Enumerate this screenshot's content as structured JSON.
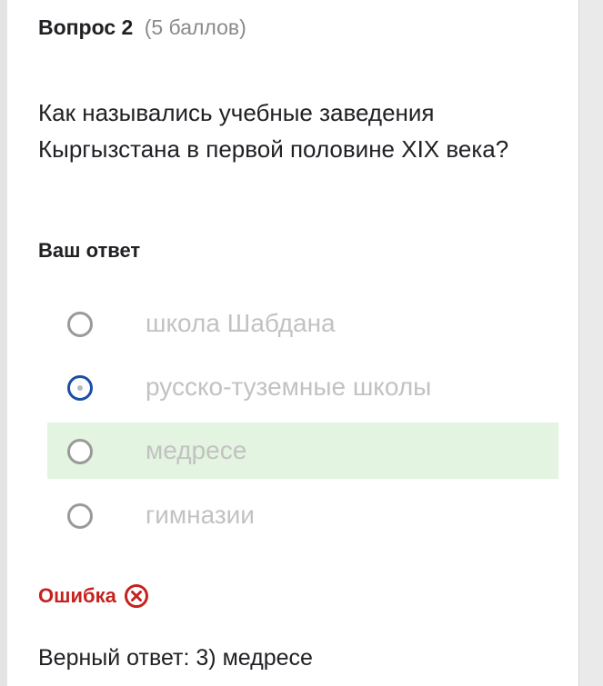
{
  "question": {
    "number_label": "Вопрос 2",
    "points_label": "(5 баллов)",
    "text": "Как назывались учебные заведения Кыргызстана в первой половине XIX века?"
  },
  "answer_section": {
    "label": "Ваш ответ"
  },
  "options": [
    {
      "label": "школа Шабдана",
      "selected": false,
      "correct": false
    },
    {
      "label": "русско-туземные школы",
      "selected": true,
      "correct": false
    },
    {
      "label": "медресе",
      "selected": false,
      "correct": true
    },
    {
      "label": "гимназии",
      "selected": false,
      "correct": false
    }
  ],
  "result": {
    "status_label": "Ошибка",
    "correct_answer_text": "Верный ответ: 3) медресе"
  },
  "colors": {
    "error": "#c5221f",
    "selected_radio": "#1a4ea8",
    "correct_highlight": "#e3f4e0",
    "muted_option_text": "#c2c2c2"
  },
  "icons": {
    "error_icon": "close-circle-icon"
  }
}
